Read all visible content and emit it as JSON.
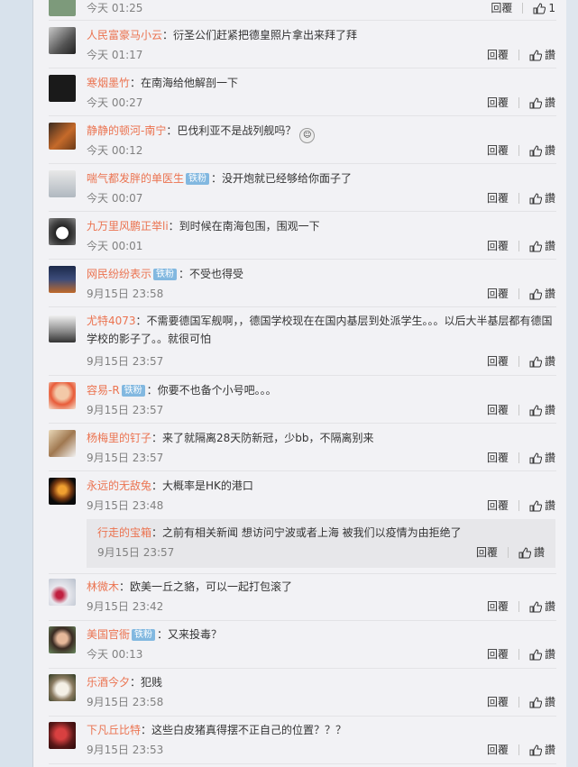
{
  "labels": {
    "reply": "回覆",
    "like": "讚"
  },
  "comments": [
    {
      "user": "",
      "text": "",
      "badge": "",
      "time": "今天 01:25",
      "likes": "1"
    },
    {
      "user": "人民富豪马小云",
      "text": "：衍圣公们赶紧把德皇照片拿出来拜了拜",
      "badge": "",
      "time": "今天 01:17",
      "likes": ""
    },
    {
      "user": "寒烟墨竹",
      "text": "：在南海给他解剖一下",
      "badge": "",
      "time": "今天 00:27",
      "likes": ""
    },
    {
      "user": "静静的顿河-南宁",
      "text": "：巴伐利亚不是战列舰吗？",
      "badge": "",
      "time": "今天 00:12",
      "likes": ""
    },
    {
      "user": "喘气都发胖的单医生",
      "text": "：没开炮就已经够给你面子了",
      "badge": "铁粉",
      "time": "今天 00:07",
      "likes": ""
    },
    {
      "user": "九万里风鹏正举li",
      "text": "：到时候在南海包围，围观一下",
      "badge": "",
      "time": "今天 00:01",
      "likes": ""
    },
    {
      "user": "网民纷纷表示",
      "text": "：不受也得受",
      "badge": "铁粉",
      "time": "9月15日 23:58",
      "likes": ""
    },
    {
      "user": "尤特4073",
      "text": "：不需要德国军舰啊，，德国学校现在在国内基层到处派学生。。。以后大半基层都有德国学校的影子了。。就很可怕",
      "badge": "",
      "time": "9月15日 23:57",
      "likes": ""
    },
    {
      "user": "容易-R",
      "text": "：你要不也备个小号吧。。。",
      "badge": "铁粉",
      "time": "9月15日 23:57",
      "likes": ""
    },
    {
      "user": "杨梅里的钉子",
      "text": "：来了就隔离28天防新冠，少bb，不隔离别来",
      "badge": "",
      "time": "9月15日 23:57",
      "likes": ""
    },
    {
      "user": "永远的无敌兔",
      "text": "：大概率是HK的港口",
      "badge": "",
      "time": "9月15日 23:48",
      "likes": ""
    },
    {
      "user": "行走的宝箱",
      "text": "：之前有相关新闻 想访问宁波或者上海 被我们以疫情为由拒绝了",
      "badge": "",
      "time": "9月15日 23:57",
      "likes": ""
    },
    {
      "user": "林微木",
      "text": "：欧美一丘之貉，可以一起打包滚了",
      "badge": "",
      "time": "9月15日 23:42",
      "likes": ""
    },
    {
      "user": "美国官衙",
      "text": "：又来投毒？",
      "badge": "铁粉",
      "time": "今天 00:13",
      "likes": ""
    },
    {
      "user": "乐酒今夕",
      "text": "：犯贱",
      "badge": "",
      "time": "9月15日 23:58",
      "likes": ""
    },
    {
      "user": "下凡丘比特",
      "text": "：这些白皮猪真得摆不正自己的位置？？？",
      "badge": "",
      "time": "9月15日 23:53",
      "likes": ""
    }
  ],
  "colors": {
    "username": "#eb7350",
    "badge": "#82b8e0",
    "panel": "#f2f2f5",
    "meta": "#808080"
  }
}
